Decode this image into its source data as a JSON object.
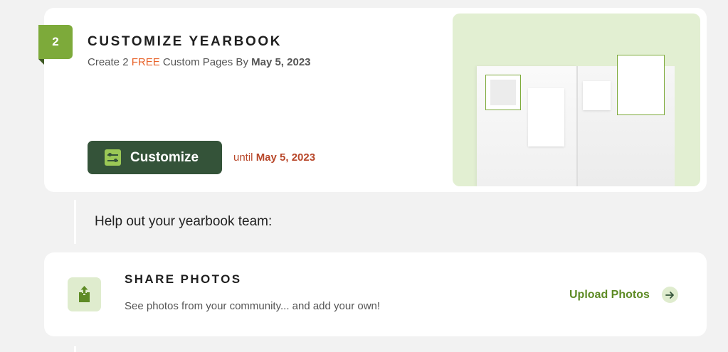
{
  "step": {
    "number": "2",
    "title": "CUSTOMIZE YEARBOOK",
    "subtitle_prefix": "Create 2 ",
    "subtitle_free": "FREE",
    "subtitle_middle": " Custom Pages By ",
    "subtitle_date": "May 5, 2023"
  },
  "customize_button": {
    "label": "Customize",
    "icon": "sliders-icon"
  },
  "deadline": {
    "prefix": "until ",
    "date": "May 5, 2023"
  },
  "help": {
    "text": "Help out your yearbook team:"
  },
  "share_photos": {
    "icon": "upload-icon",
    "title": "SHARE PHOTOS",
    "subtitle": "See photos from your community... and add your own!",
    "link_label": "Upload Photos",
    "link_icon": "arrow-right-icon"
  },
  "colors": {
    "accent_green": "#7daa3a",
    "button_dark_green": "#345339",
    "free_orange": "#e8632a",
    "deadline_red": "#b8472a",
    "link_green": "#5e8b25",
    "light_green_bg": "#dfecce"
  }
}
